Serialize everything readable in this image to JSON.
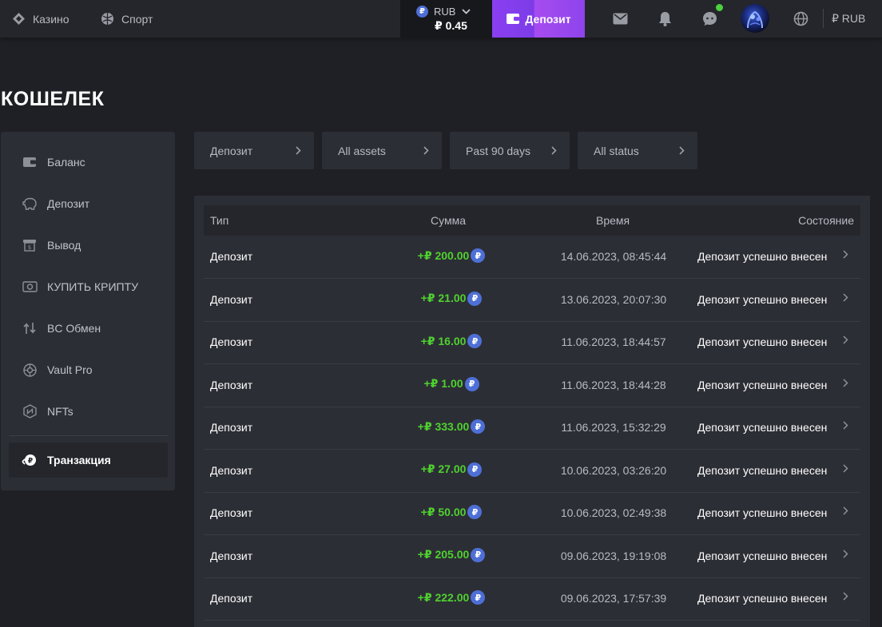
{
  "topbar": {
    "nav": [
      {
        "label": "Казино",
        "icon": "casino-icon"
      },
      {
        "label": "Спорт",
        "icon": "sport-icon"
      }
    ],
    "balance": {
      "currency": "RUB",
      "amount": "₽ 0.45",
      "coin_symbol": "₽"
    },
    "deposit_label": "Депозит",
    "icons": [
      "mail-icon",
      "bell-icon",
      "chat-icon",
      "globe-icon"
    ],
    "currency_selector": "₽ RUB"
  },
  "page": {
    "title": "КОШЕЛЕК"
  },
  "sidebar": {
    "items": [
      {
        "label": "Баланс",
        "icon": "wallet-icon"
      },
      {
        "label": "Депозит",
        "icon": "piggy-bank-icon"
      },
      {
        "label": "Вывод",
        "icon": "withdraw-icon"
      },
      {
        "label": "КУПИТЬ КРИПТУ",
        "icon": "buy-crypto-icon"
      },
      {
        "label": "BC Обмен",
        "icon": "exchange-icon"
      },
      {
        "label": "Vault Pro",
        "icon": "vault-icon"
      },
      {
        "label": "NFTs",
        "icon": "nft-icon"
      }
    ],
    "active": {
      "label": "Транзакция",
      "icon": "transaction-icon"
    }
  },
  "filters": [
    {
      "label": "Депозит"
    },
    {
      "label": "All assets"
    },
    {
      "label": "Past 90 days"
    },
    {
      "label": "All status"
    }
  ],
  "table": {
    "headers": {
      "type": "Тип",
      "amount": "Сумма",
      "time": "Время",
      "status": "Состояние"
    },
    "coin_symbol": "₽",
    "rows": [
      {
        "type": "Депозит",
        "amount": "+₽ 200.00",
        "time": "14.06.2023, 08:45:44",
        "status": "Депозит успешно внесен"
      },
      {
        "type": "Депозит",
        "amount": "+₽ 21.00",
        "time": "13.06.2023, 20:07:30",
        "status": "Депозит успешно внесен"
      },
      {
        "type": "Депозит",
        "amount": "+₽ 16.00",
        "time": "11.06.2023, 18:44:57",
        "status": "Депозит успешно внесен"
      },
      {
        "type": "Депозит",
        "amount": "+₽ 1.00",
        "time": "11.06.2023, 18:44:28",
        "status": "Депозит успешно внесен"
      },
      {
        "type": "Депозит",
        "amount": "+₽ 333.00",
        "time": "11.06.2023, 15:32:29",
        "status": "Депозит успешно внесен"
      },
      {
        "type": "Депозит",
        "amount": "+₽ 27.00",
        "time": "10.06.2023, 03:26:20",
        "status": "Депозит успешно внесен"
      },
      {
        "type": "Депозит",
        "amount": "+₽ 50.00",
        "time": "10.06.2023, 02:49:38",
        "status": "Депозит успешно внесен"
      },
      {
        "type": "Депозит",
        "amount": "+₽ 205.00",
        "time": "09.06.2023, 19:19:08",
        "status": "Депозит успешно внесен"
      },
      {
        "type": "Депозит",
        "amount": "+₽ 222.00",
        "time": "09.06.2023, 17:57:39",
        "status": "Депозит успешно внесен"
      }
    ]
  },
  "colors": {
    "accent": "#8a3ff0",
    "positive": "#4fd12f",
    "coin": "#4e6fd6",
    "online": "#4cd03c"
  }
}
